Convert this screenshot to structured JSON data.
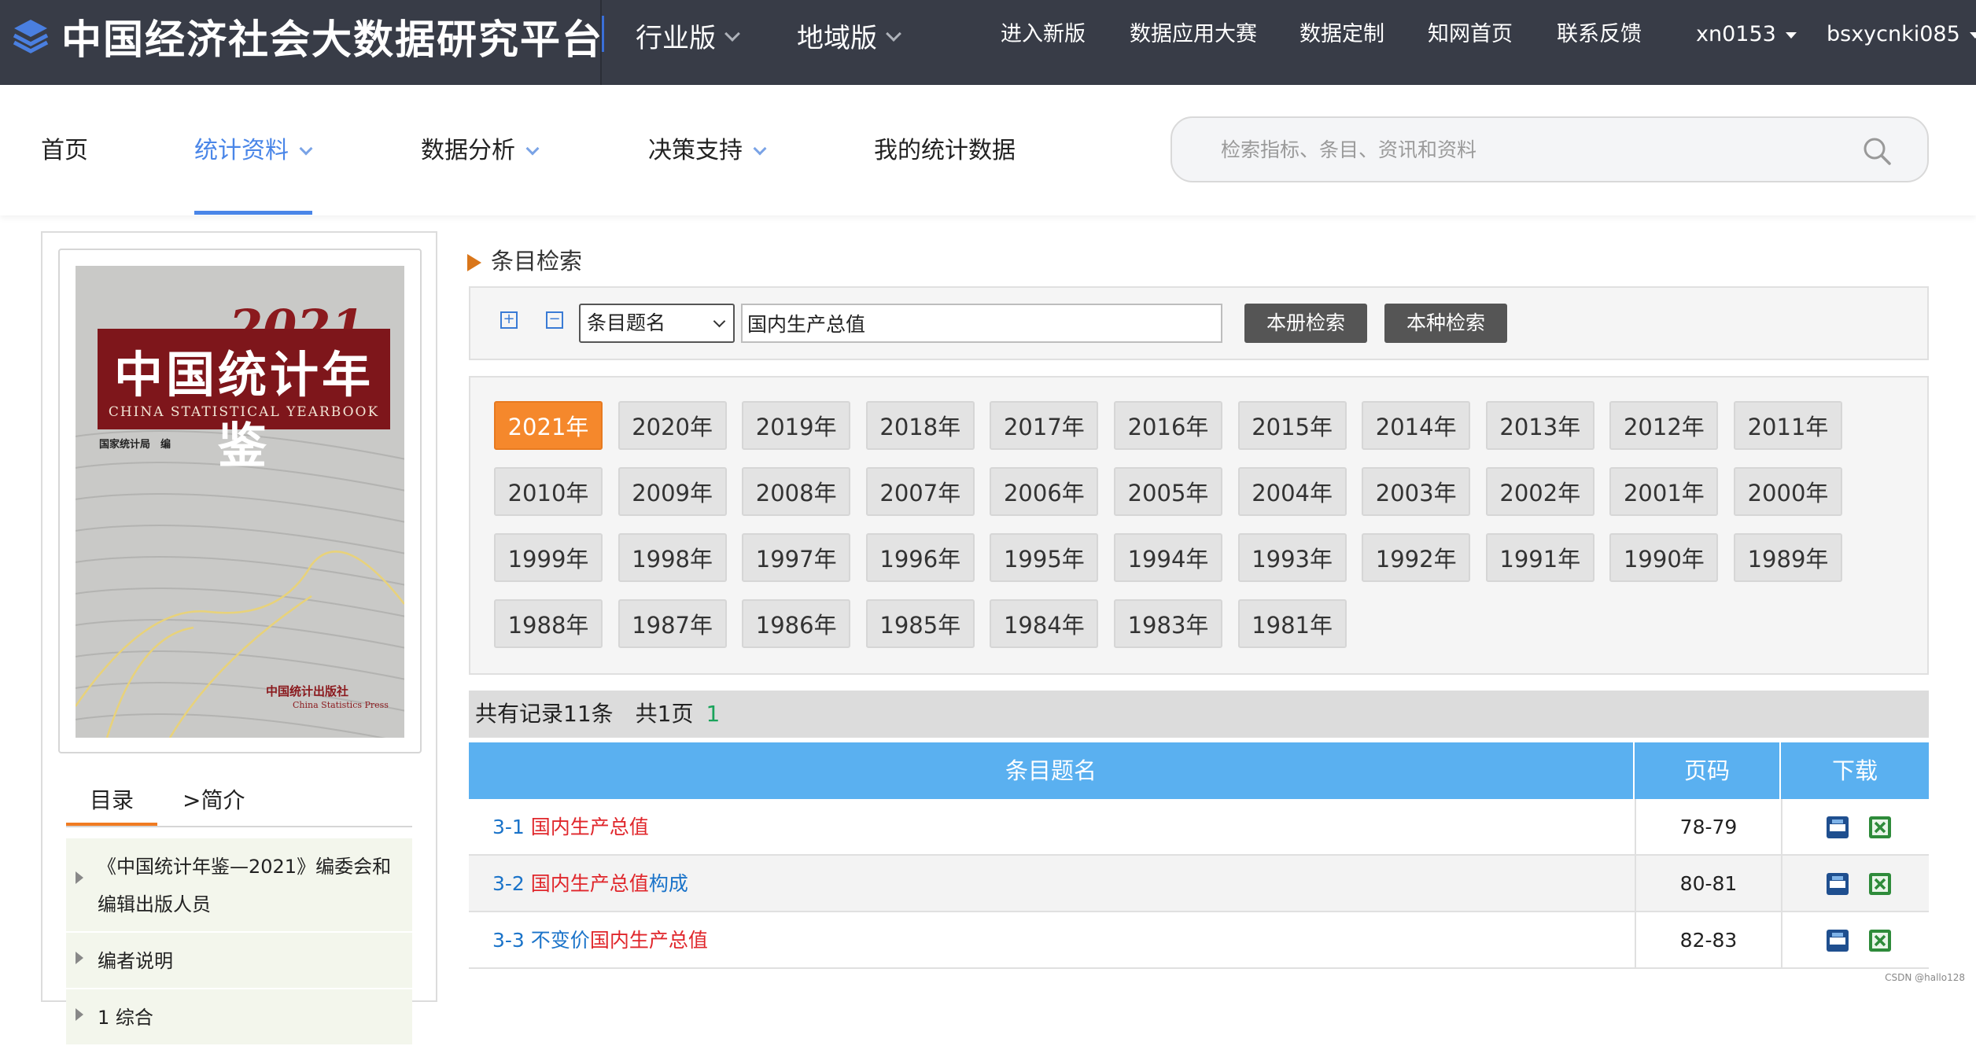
{
  "header": {
    "title": "中国经济社会大数据研究平台",
    "editions": [
      "行业版",
      "地域版"
    ],
    "links": [
      "进入新版",
      "数据应用大赛",
      "数据定制",
      "知网首页",
      "联系反馈"
    ],
    "user1": "xn0153",
    "user2": "bsxycnki085"
  },
  "nav": {
    "items": [
      "首页",
      "统计资料",
      "数据分析",
      "决策支持",
      "我的统计数据"
    ],
    "active": "统计资料",
    "search_placeholder": "检索指标、条目、资讯和资料"
  },
  "sidebar": {
    "cover": {
      "year": "2021",
      "title": "中国统计年鉴",
      "subtitle": "CHINA STATISTICAL YEARBOOK",
      "compiler": "国家统计局　编",
      "publisher": "中国统计出版社",
      "publisher_en": "China Statistics Press"
    },
    "tabs": [
      "目录",
      ">简介"
    ],
    "tree": [
      "《中国统计年鉴—2021》编委会和编辑出版人员",
      "编者说明",
      "1 综合"
    ]
  },
  "search": {
    "section_title": "条目检索",
    "field_select": "条目题名",
    "query": "国内生产总值",
    "buttons": [
      "本册检索",
      "本种检索"
    ]
  },
  "years": {
    "active": "2021年",
    "list": [
      "2021年",
      "2020年",
      "2019年",
      "2018年",
      "2017年",
      "2016年",
      "2015年",
      "2014年",
      "2013年",
      "2012年",
      "2011年",
      "2010年",
      "2009年",
      "2008年",
      "2007年",
      "2006年",
      "2005年",
      "2004年",
      "2003年",
      "2002年",
      "2001年",
      "2000年",
      "1999年",
      "1998年",
      "1997年",
      "1996年",
      "1995年",
      "1994年",
      "1993年",
      "1992年",
      "1991年",
      "1990年",
      "1989年",
      "1988年",
      "1987年",
      "1986年",
      "1985年",
      "1984年",
      "1983年",
      "1981年"
    ]
  },
  "results": {
    "summary": "共有记录11条　共1页",
    "current_page": "1",
    "columns": [
      "条目题名",
      "页码",
      "下载"
    ],
    "rows": [
      {
        "num": "3-1",
        "parts": [
          {
            "t": "国内生产总值",
            "c": "hl"
          }
        ],
        "pages": "78-79"
      },
      {
        "num": "3-2",
        "parts": [
          {
            "t": "国内生产总值",
            "c": "hl"
          },
          {
            "t": "构成",
            "c": "blue"
          }
        ],
        "pages": "80-81"
      },
      {
        "num": "3-3",
        "parts": [
          {
            "t": "不变价",
            "c": "blue"
          },
          {
            "t": "国内生产总值",
            "c": "hl"
          }
        ],
        "pages": "82-83"
      }
    ]
  },
  "download_icons": [
    "caj-icon",
    "excel-icon"
  ],
  "colors": {
    "accent_blue": "#4a86e8",
    "active_year": "#f5882c",
    "table_header": "#5ab0f0",
    "highlight_red": "#e0262b",
    "link_blue": "#1a73c9",
    "header_bg": "#383c47"
  },
  "watermark": "CSDN @hallo128"
}
